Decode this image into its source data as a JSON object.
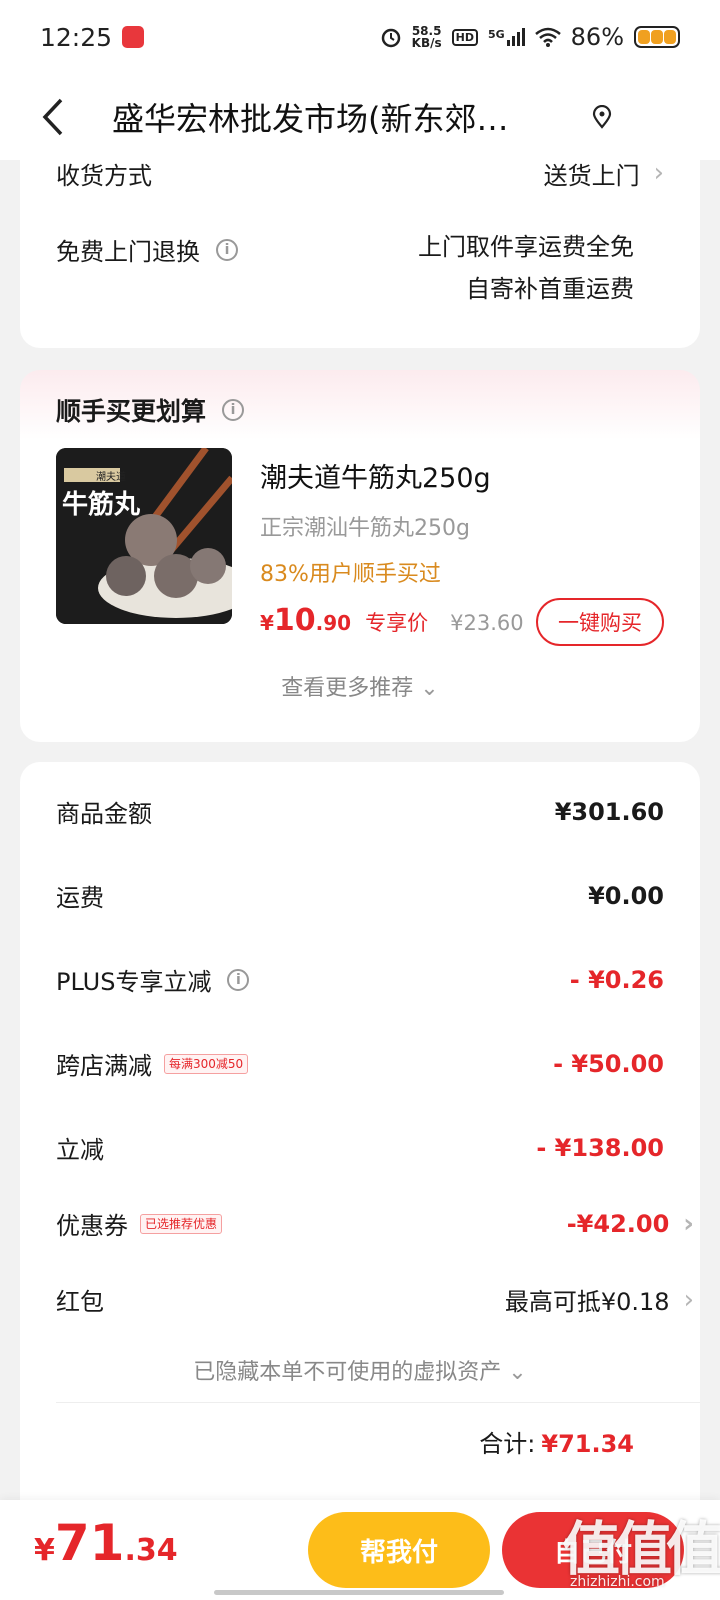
{
  "status_bar": {
    "time": "12:25",
    "net_speed_value": "58.5",
    "net_speed_unit": "KB/s",
    "hd": "HD",
    "network": "5G",
    "battery": "86%"
  },
  "nav": {
    "title": "盛华宏林批发市场(新东郊…"
  },
  "delivery": {
    "method_label": "收货方式",
    "method_value": "送货上门",
    "return_label": "免费上门退换",
    "return_value_line1": "上门取件享运费全免",
    "return_value_line2": "自寄补首重运费"
  },
  "recommend": {
    "title": "顺手买更划算",
    "product_name": "潮夫道牛筋丸250g",
    "product_subtitle": "正宗潮汕牛筋丸250g",
    "users_bought": "83%用户顺手买过",
    "price_currency": "¥",
    "price_int": "10",
    "price_dec": ".90",
    "price_tag": "专享价",
    "price_original": "¥23.60",
    "buy_button": "一键购买",
    "more_link": "查看更多推荐",
    "image_brand_text": "潮夫道",
    "image_title_text": "牛筋丸"
  },
  "summary": {
    "rows": [
      {
        "label": "商品金额",
        "amount": "¥301.60"
      },
      {
        "label": "运费",
        "amount": "¥0.00"
      },
      {
        "label": "PLUS专享立减",
        "amount": "- ¥0.26"
      },
      {
        "label": "跨店满减",
        "tag": "每满300减50",
        "amount": "- ¥50.00"
      },
      {
        "label": "立减",
        "amount": "- ¥138.00"
      },
      {
        "label": "优惠券",
        "tag": "已选推荐优惠",
        "amount": "-¥42.00"
      },
      {
        "label": "红包",
        "amount": "最高可抵¥0.18"
      }
    ],
    "hidden_assets": "已隐藏本单不可使用的虚拟资产",
    "total_label": "合计:",
    "total_amount": "¥71.34"
  },
  "bottom": {
    "currency": "¥",
    "pay_int": "71",
    "pay_dec": ".34",
    "help_pay": "帮我付",
    "self_pay": "自己付"
  },
  "watermark": {
    "big": "值值值",
    "site": "zhizhizhi.com"
  },
  "colors": {
    "accent_red": "#e5262a",
    "orange": "#d98a1e",
    "yellow_button": "#fdbd19",
    "red_button": "#ea3334"
  },
  "icons": {
    "back": "back-arrow-icon",
    "location": "location-pin-icon",
    "info": "info-icon",
    "chevron": "chevron-right-icon"
  }
}
